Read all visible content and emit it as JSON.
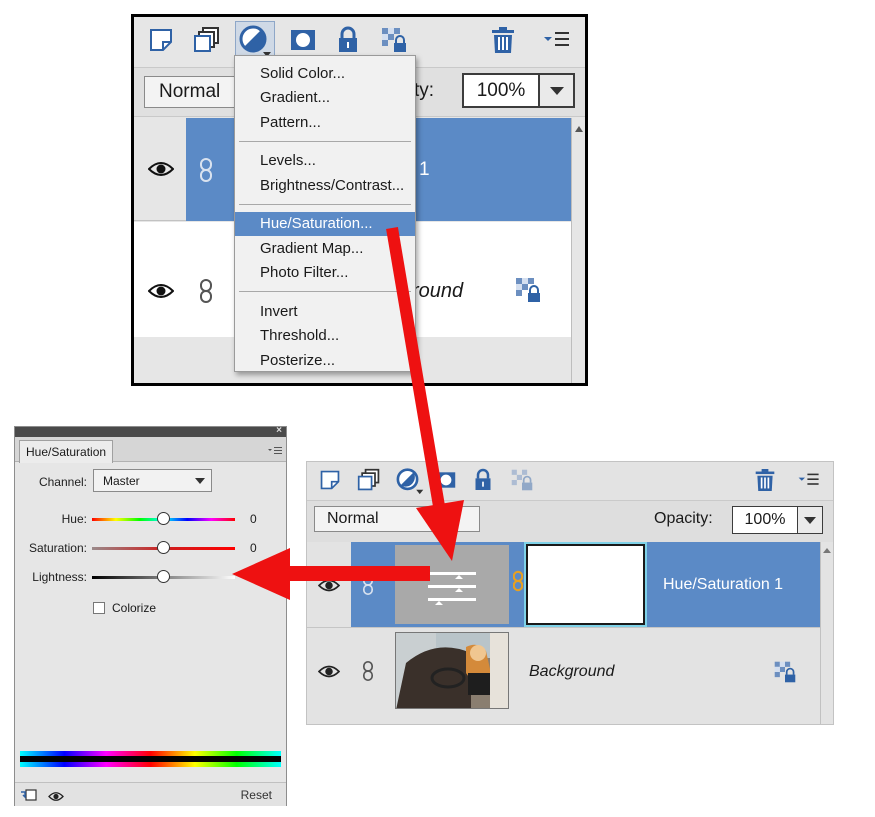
{
  "top_panel": {
    "blend_mode": "Normal",
    "opacity_label_visible": "ty:",
    "opacity_value": "100%",
    "layer1_name_fragment": "1",
    "layer2_name_fragment": "round",
    "adjustment_menu": {
      "groups": [
        [
          "Solid Color...",
          "Gradient...",
          "Pattern..."
        ],
        [
          "Levels...",
          "Brightness/Contrast..."
        ],
        [
          "Hue/Saturation...",
          "Gradient Map...",
          "Photo Filter..."
        ],
        [
          "Invert",
          "Threshold...",
          "Posterize..."
        ]
      ],
      "highlighted": "Hue/Saturation..."
    }
  },
  "hue_saturation_panel": {
    "tab_title": "Hue/Saturation",
    "channel_label": "Channel:",
    "channel_value": "Master",
    "sliders": [
      {
        "label": "Hue:",
        "value": "0",
        "position": 0.5
      },
      {
        "label": "Saturation:",
        "value": "0",
        "position": 0.5
      },
      {
        "label": "Lightness:",
        "value": "",
        "position": 0.5
      }
    ],
    "colorize_label": "Colorize",
    "colorize_checked": false,
    "reset_label": "Reset"
  },
  "bottom_panel": {
    "blend_mode": "Normal",
    "opacity_label": "Opacity:",
    "opacity_value": "100%",
    "layers": [
      {
        "name": "Hue/Saturation 1",
        "selected": true
      },
      {
        "name": "Background",
        "selected": false
      }
    ]
  },
  "colors": {
    "selection_blue": "#5b8ac6",
    "arrow_red": "#ee1111",
    "panel_gray": "#e6e6e6",
    "icon_blue": "#2f62a6"
  }
}
